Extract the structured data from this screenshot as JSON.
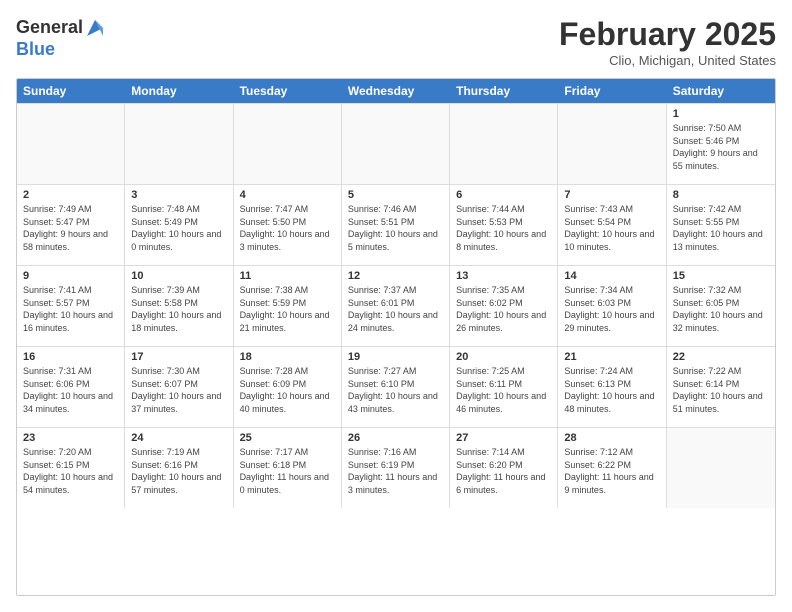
{
  "logo": {
    "general": "General",
    "blue": "Blue"
  },
  "title": "February 2025",
  "location": "Clio, Michigan, United States",
  "days_of_week": [
    "Sunday",
    "Monday",
    "Tuesday",
    "Wednesday",
    "Thursday",
    "Friday",
    "Saturday"
  ],
  "rows": [
    [
      {
        "day": "",
        "text": ""
      },
      {
        "day": "",
        "text": ""
      },
      {
        "day": "",
        "text": ""
      },
      {
        "day": "",
        "text": ""
      },
      {
        "day": "",
        "text": ""
      },
      {
        "day": "",
        "text": ""
      },
      {
        "day": "1",
        "text": "Sunrise: 7:50 AM\nSunset: 5:46 PM\nDaylight: 9 hours and 55 minutes."
      }
    ],
    [
      {
        "day": "2",
        "text": "Sunrise: 7:49 AM\nSunset: 5:47 PM\nDaylight: 9 hours and 58 minutes."
      },
      {
        "day": "3",
        "text": "Sunrise: 7:48 AM\nSunset: 5:49 PM\nDaylight: 10 hours and 0 minutes."
      },
      {
        "day": "4",
        "text": "Sunrise: 7:47 AM\nSunset: 5:50 PM\nDaylight: 10 hours and 3 minutes."
      },
      {
        "day": "5",
        "text": "Sunrise: 7:46 AM\nSunset: 5:51 PM\nDaylight: 10 hours and 5 minutes."
      },
      {
        "day": "6",
        "text": "Sunrise: 7:44 AM\nSunset: 5:53 PM\nDaylight: 10 hours and 8 minutes."
      },
      {
        "day": "7",
        "text": "Sunrise: 7:43 AM\nSunset: 5:54 PM\nDaylight: 10 hours and 10 minutes."
      },
      {
        "day": "8",
        "text": "Sunrise: 7:42 AM\nSunset: 5:55 PM\nDaylight: 10 hours and 13 minutes."
      }
    ],
    [
      {
        "day": "9",
        "text": "Sunrise: 7:41 AM\nSunset: 5:57 PM\nDaylight: 10 hours and 16 minutes."
      },
      {
        "day": "10",
        "text": "Sunrise: 7:39 AM\nSunset: 5:58 PM\nDaylight: 10 hours and 18 minutes."
      },
      {
        "day": "11",
        "text": "Sunrise: 7:38 AM\nSunset: 5:59 PM\nDaylight: 10 hours and 21 minutes."
      },
      {
        "day": "12",
        "text": "Sunrise: 7:37 AM\nSunset: 6:01 PM\nDaylight: 10 hours and 24 minutes."
      },
      {
        "day": "13",
        "text": "Sunrise: 7:35 AM\nSunset: 6:02 PM\nDaylight: 10 hours and 26 minutes."
      },
      {
        "day": "14",
        "text": "Sunrise: 7:34 AM\nSunset: 6:03 PM\nDaylight: 10 hours and 29 minutes."
      },
      {
        "day": "15",
        "text": "Sunrise: 7:32 AM\nSunset: 6:05 PM\nDaylight: 10 hours and 32 minutes."
      }
    ],
    [
      {
        "day": "16",
        "text": "Sunrise: 7:31 AM\nSunset: 6:06 PM\nDaylight: 10 hours and 34 minutes."
      },
      {
        "day": "17",
        "text": "Sunrise: 7:30 AM\nSunset: 6:07 PM\nDaylight: 10 hours and 37 minutes."
      },
      {
        "day": "18",
        "text": "Sunrise: 7:28 AM\nSunset: 6:09 PM\nDaylight: 10 hours and 40 minutes."
      },
      {
        "day": "19",
        "text": "Sunrise: 7:27 AM\nSunset: 6:10 PM\nDaylight: 10 hours and 43 minutes."
      },
      {
        "day": "20",
        "text": "Sunrise: 7:25 AM\nSunset: 6:11 PM\nDaylight: 10 hours and 46 minutes."
      },
      {
        "day": "21",
        "text": "Sunrise: 7:24 AM\nSunset: 6:13 PM\nDaylight: 10 hours and 48 minutes."
      },
      {
        "day": "22",
        "text": "Sunrise: 7:22 AM\nSunset: 6:14 PM\nDaylight: 10 hours and 51 minutes."
      }
    ],
    [
      {
        "day": "23",
        "text": "Sunrise: 7:20 AM\nSunset: 6:15 PM\nDaylight: 10 hours and 54 minutes."
      },
      {
        "day": "24",
        "text": "Sunrise: 7:19 AM\nSunset: 6:16 PM\nDaylight: 10 hours and 57 minutes."
      },
      {
        "day": "25",
        "text": "Sunrise: 7:17 AM\nSunset: 6:18 PM\nDaylight: 11 hours and 0 minutes."
      },
      {
        "day": "26",
        "text": "Sunrise: 7:16 AM\nSunset: 6:19 PM\nDaylight: 11 hours and 3 minutes."
      },
      {
        "day": "27",
        "text": "Sunrise: 7:14 AM\nSunset: 6:20 PM\nDaylight: 11 hours and 6 minutes."
      },
      {
        "day": "28",
        "text": "Sunrise: 7:12 AM\nSunset: 6:22 PM\nDaylight: 11 hours and 9 minutes."
      },
      {
        "day": "",
        "text": ""
      }
    ]
  ]
}
